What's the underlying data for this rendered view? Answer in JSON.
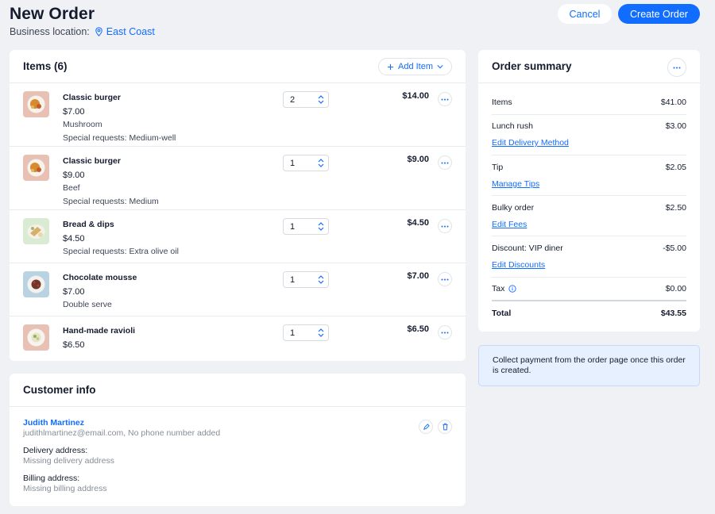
{
  "header": {
    "title": "New Order",
    "location_label": "Business location:",
    "location_value": "East Coast",
    "cancel_label": "Cancel",
    "create_label": "Create Order"
  },
  "items_card": {
    "title": "Items (6)",
    "add_item_label": "Add Item",
    "items": [
      {
        "name": "Classic burger",
        "price": "$7.00",
        "notes": [
          "Mushroom",
          "Special requests: Medium-well"
        ],
        "qty": "2",
        "total": "$14.00",
        "thumb": "burger-image",
        "bg": "#e8c0b4"
      },
      {
        "name": "Classic burger",
        "price": "$9.00",
        "notes": [
          "Beef",
          "Special requests: Medium"
        ],
        "qty": "1",
        "total": "$9.00",
        "thumb": "burger-image",
        "bg": "#e8c0b4"
      },
      {
        "name": "Bread & dips",
        "price": "$4.50",
        "notes": [
          "Special requests: Extra olive oil"
        ],
        "qty": "1",
        "total": "$4.50",
        "thumb": "bread-image",
        "bg": "#d9ecd3"
      },
      {
        "name": "Chocolate mousse",
        "price": "$7.00",
        "notes": [
          "Double serve"
        ],
        "qty": "1",
        "total": "$7.00",
        "thumb": "mousse-image",
        "bg": "#b9d3e3"
      },
      {
        "name": "Hand-made ravioli",
        "price": "$6.50",
        "notes": [],
        "qty": "1",
        "total": "$6.50",
        "thumb": "ravioli-image",
        "bg": "#e8c0b4"
      }
    ]
  },
  "customer_card": {
    "title": "Customer info",
    "name": "Judith Martinez",
    "contact": "judithlmartinez@email.com, No phone number added",
    "delivery_label": "Delivery address:",
    "delivery_value": "Missing delivery address",
    "billing_label": "Billing address:",
    "billing_value": "Missing billing address"
  },
  "summary_card": {
    "title": "Order summary",
    "items_label": "Items",
    "items_value": "$41.00",
    "lunch_label": "Lunch rush",
    "lunch_value": "$3.00",
    "lunch_link": "Edit Delivery Method",
    "tip_label": "Tip",
    "tip_value": "$2.05",
    "tip_link": "Manage Tips",
    "bulky_label": "Bulky order",
    "bulky_value": "$2.50",
    "bulky_link": "Edit Fees",
    "discount_label": "Discount: VIP diner",
    "discount_value": "-$5.00",
    "discount_link": "Edit Discounts",
    "tax_label": "Tax",
    "tax_value": "$0.00",
    "total_label": "Total",
    "total_value": "$43.55"
  },
  "info_box": {
    "text": "Collect payment from the order page once this order is created."
  },
  "colors": {
    "accent": "#116dff",
    "background": "#eff1f5",
    "info_bg": "#e7f0ff"
  }
}
